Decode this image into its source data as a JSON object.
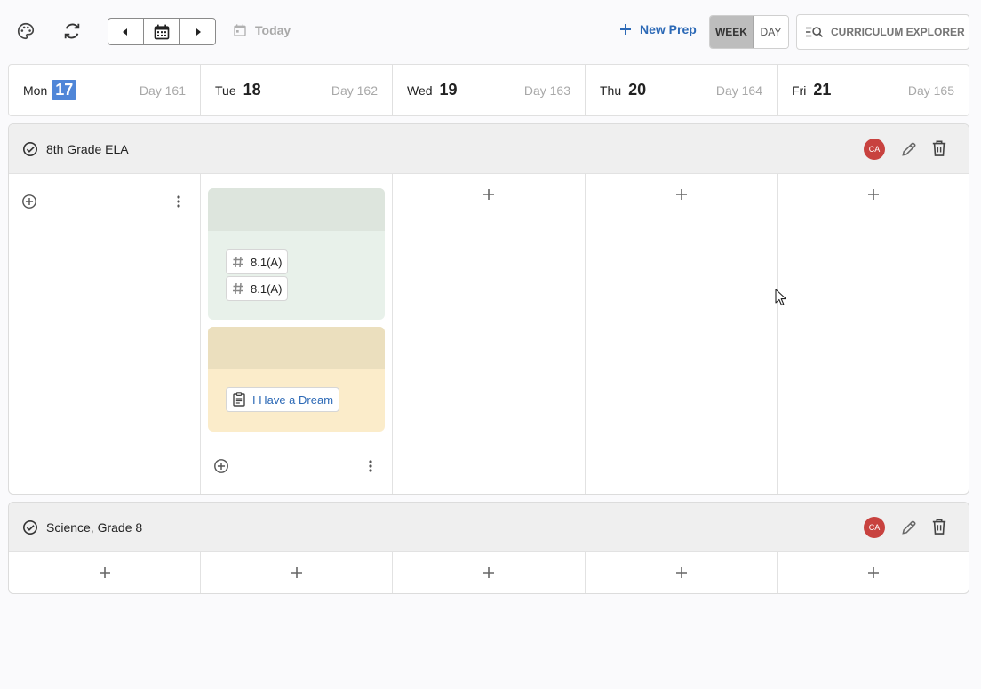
{
  "toolbar": {
    "palette_icon": "palette-icon",
    "sync_icon": "sync-icon",
    "prev_icon": "caret-left-icon",
    "calendar_icon": "calendar-icon",
    "next_icon": "caret-right-icon",
    "today_label": "Today",
    "new_prep_label": "New Prep",
    "view_week": "WEEK",
    "view_day": "DAY",
    "selected_view": "WEEK",
    "explorer_label": "CURRICULUM EXPLORER"
  },
  "days": [
    {
      "name": "Mon",
      "num": "17",
      "day": "Day 161",
      "today": true
    },
    {
      "name": "Tue",
      "num": "18",
      "day": "Day 162",
      "today": false
    },
    {
      "name": "Wed",
      "num": "19",
      "day": "Day 163",
      "today": false
    },
    {
      "name": "Thu",
      "num": "20",
      "day": "Day 164",
      "today": false
    },
    {
      "name": "Fri",
      "num": "21",
      "day": "Day 165",
      "today": false
    }
  ],
  "preps": [
    {
      "title": "8th Grade ELA",
      "avatar": "CA",
      "lessons": {
        "tue": [
          {
            "color": "#e8f1ea",
            "header_color": "#dde5dd",
            "chips": [
              {
                "icon": "hashtag-icon",
                "text": "8.1(A)"
              },
              {
                "icon": "hashtag-icon",
                "text": "8.1(A)"
              }
            ]
          },
          {
            "color": "#fbecca",
            "header_color": "#ebdfbe",
            "chips": [
              {
                "icon": "document-icon",
                "text": "I Have a Dream"
              }
            ]
          }
        ]
      }
    },
    {
      "title": "Science, Grade 8",
      "avatar": "CA"
    }
  ],
  "colors": {
    "accent": "#2c69b6",
    "today_highlight": "#4f86d8",
    "avatar": "#c8423f"
  }
}
